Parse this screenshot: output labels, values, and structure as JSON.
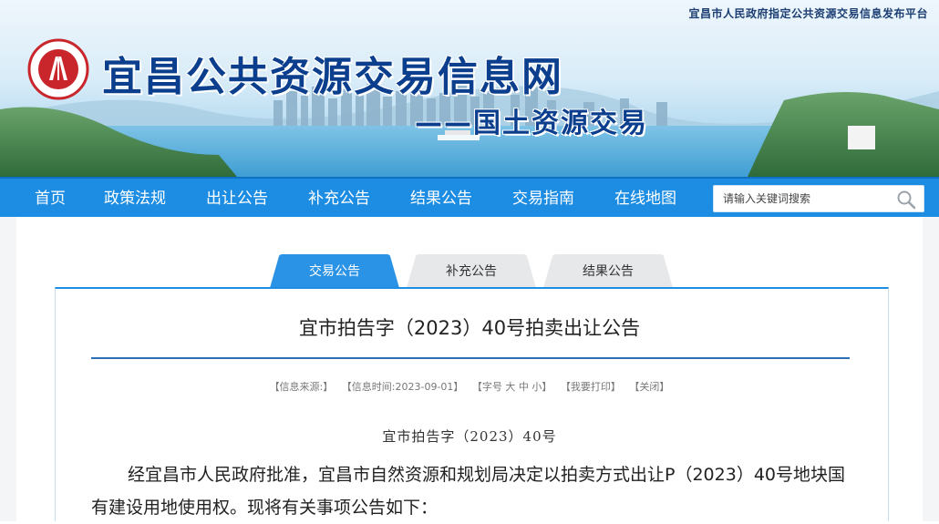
{
  "header": {
    "platform_note": "宜昌市人民政府指定公共资源交易信息发布平台",
    "site_title": "宜昌公共资源交易信息网",
    "site_subtitle": "——国土资源交易",
    "logo_icon": "yichang-public-resource-logo-icon"
  },
  "nav": {
    "items": [
      {
        "label": "首页"
      },
      {
        "label": "政策法规"
      },
      {
        "label": "出让公告"
      },
      {
        "label": "补充公告"
      },
      {
        "label": "结果公告"
      },
      {
        "label": "交易指南"
      },
      {
        "label": "在线地图"
      }
    ],
    "search": {
      "placeholder": "请输入关键词搜索",
      "icon": "search-icon"
    }
  },
  "tabs": [
    {
      "label": "交易公告",
      "active": true
    },
    {
      "label": "补充公告",
      "active": false
    },
    {
      "label": "结果公告",
      "active": false
    }
  ],
  "article": {
    "title": "宜市拍告字（2023）40号拍卖出让公告",
    "meta": {
      "source": "【信息来源:】",
      "time": "【信息时间:2023-09-01】",
      "font_size": "【字号 大 中 小】",
      "print": "【我要打印】",
      "close": "【关闭】"
    },
    "doc_number": "宜市拍告字（2023）40号",
    "paragraph": "经宜昌市人民政府批准，宜昌市自然资源和规划局决定以拍卖方式出让P（2023）40号地块国有建设用地使用权。现将有关事项公告如下："
  },
  "colors": {
    "nav_blue": "#1c8de3",
    "title_blue": "#0b3f8e",
    "rule_blue": "#2d6fb4"
  }
}
